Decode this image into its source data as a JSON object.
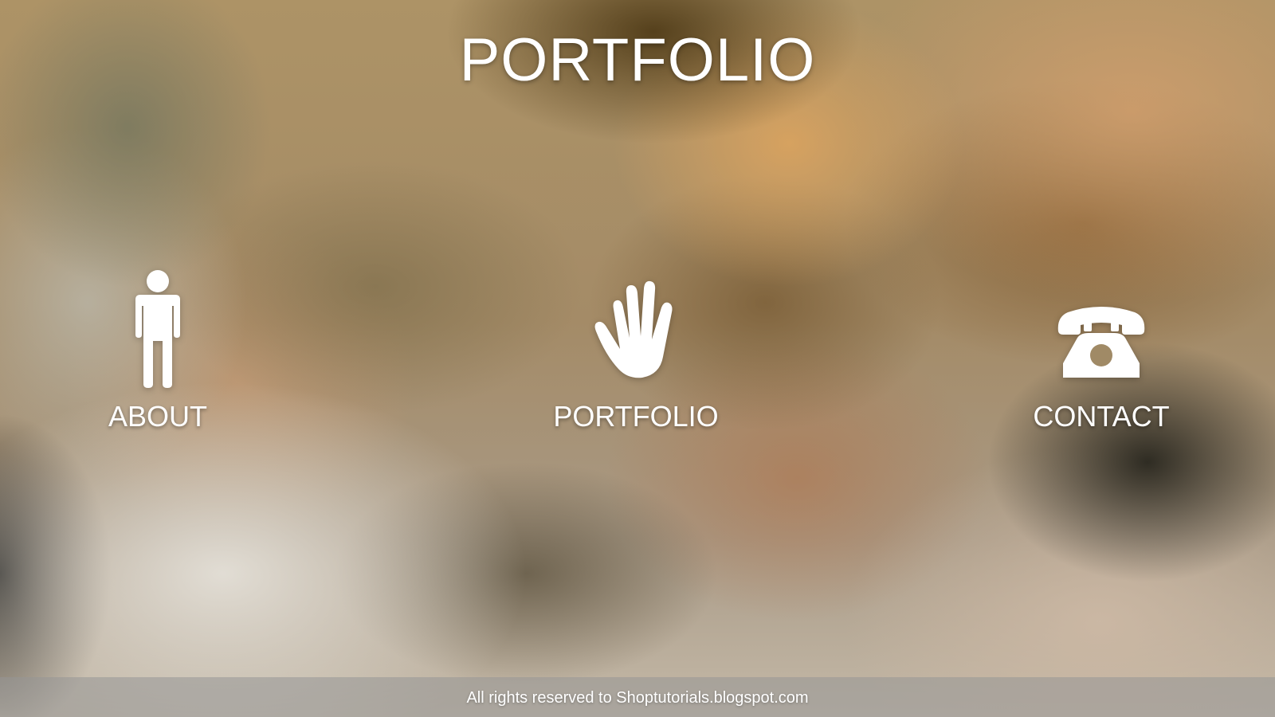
{
  "header": {
    "title": "PORTFOLIO"
  },
  "nav": {
    "items": [
      {
        "label": "ABOUT",
        "icon": "person-icon"
      },
      {
        "label": "PORTFOLIO",
        "icon": "hand-icon"
      },
      {
        "label": "CONTACT",
        "icon": "telephone-icon"
      }
    ]
  },
  "footer": {
    "text": "All rights reserved to Shoptutorials.blogspot.com"
  },
  "colors": {
    "text": "#ffffff",
    "footer_bar": "#969696"
  }
}
